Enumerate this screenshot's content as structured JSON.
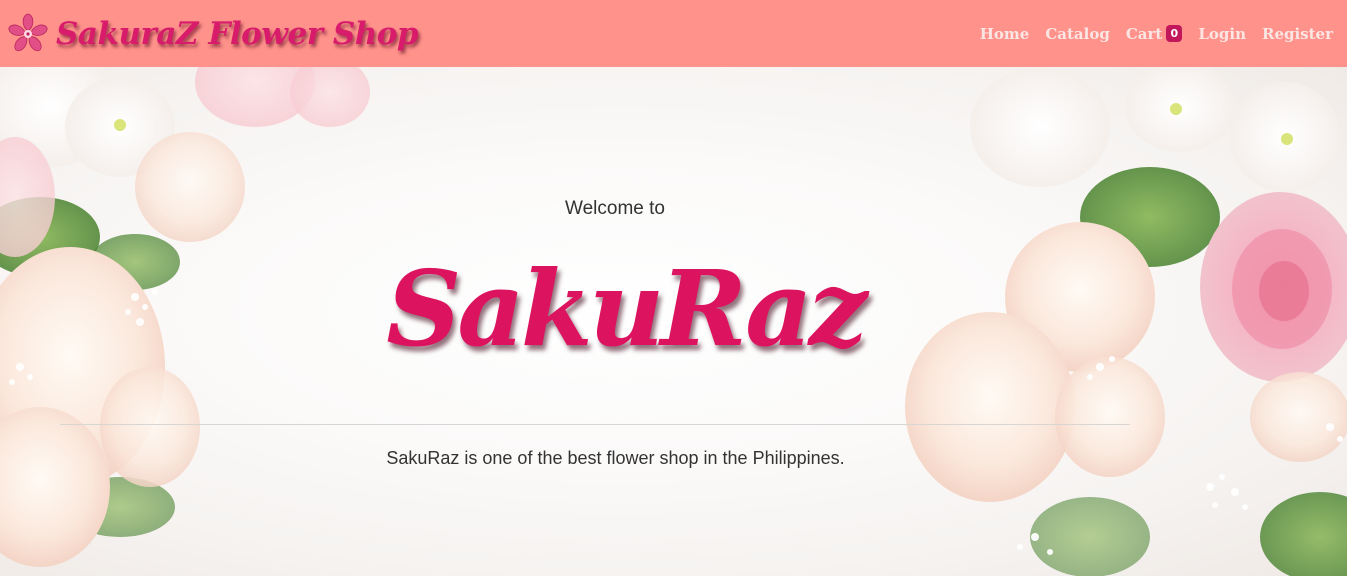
{
  "navbar": {
    "brand_name": "SakuraZ Flower Shop",
    "brand_icon": "sakura-flower-icon",
    "links": {
      "home": "Home",
      "catalog": "Catalog",
      "cart": "Cart",
      "cart_count": "0",
      "login": "Login",
      "register": "Register"
    }
  },
  "hero": {
    "welcome": "Welcome to",
    "title": "SakuRaz",
    "tagline": "SakuRaz is one of the best flower shop in the Philippines."
  },
  "colors": {
    "navbar_bg": "#ff928b",
    "brand_text": "#d81b6a",
    "nav_link": "#fbe6e4",
    "badge_bg": "#c2185b",
    "hero_title": "#dc145f"
  }
}
